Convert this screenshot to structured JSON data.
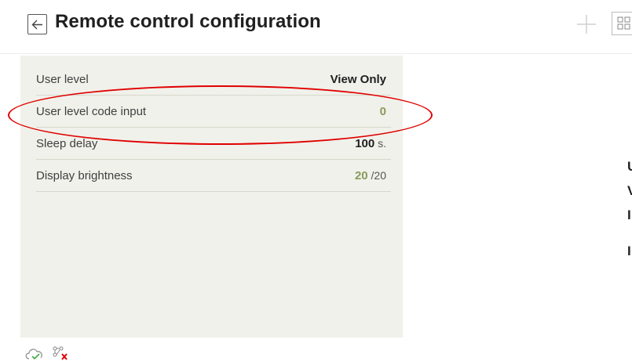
{
  "header": {
    "title": "Remote control configuration"
  },
  "settings": [
    {
      "label": "User level",
      "value": "View Only",
      "unit": ""
    },
    {
      "label": "User level code input",
      "value": "0",
      "unit": ""
    },
    {
      "label": "Sleep delay",
      "value": "100",
      "unit": "s."
    },
    {
      "label": "Display brightness",
      "value": "20",
      "unit": "/20"
    }
  ],
  "right_panel": {
    "partial_chars": [
      "U",
      "V",
      "I",
      "I"
    ]
  },
  "colors": {
    "panel_bg": "#f0f1ea",
    "accent_green": "#8a9a5b",
    "annotation_red": "#e00000"
  },
  "icons": {
    "back": "arrow-left-icon",
    "add": "plus-icon",
    "grid": "grid-icon",
    "cloud_ok": "cloud-check-icon",
    "network_error": "network-error-icon"
  }
}
